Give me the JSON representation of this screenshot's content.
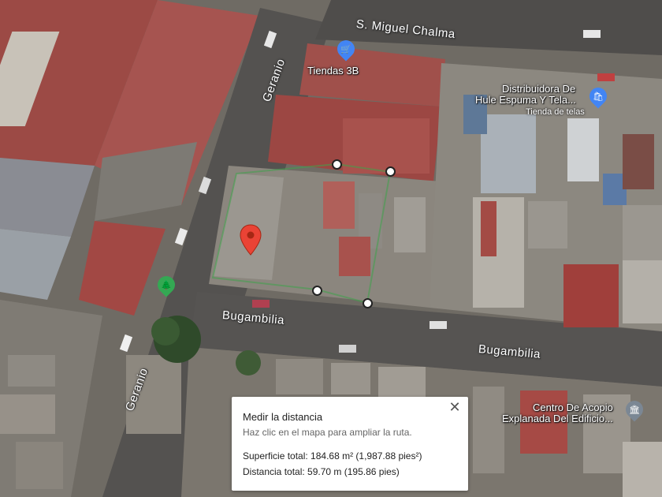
{
  "map": {
    "streets": {
      "miguel_chalma": "S. Miguel Chalma",
      "geranio_top": "Geranio",
      "geranio_bottom": "Geranio",
      "bugambilia_left": "Bugambilia",
      "bugambilia_right": "Bugambilia"
    },
    "pois": {
      "tiendas": {
        "name": "Tiendas 3B",
        "icon": "shopping-cart-icon",
        "color": "#4285f4"
      },
      "distribuidora": {
        "name_line1": "Distribuidora De",
        "name_line2": "Hule Espuma Y Tela...",
        "category": "Tienda de telas",
        "icon": "shopping-bag-icon",
        "color": "#4285f4"
      },
      "centro": {
        "name_line1": "Centro De Acopio",
        "name_line2": "Explanada Del Edificio...",
        "icon": "building-icon",
        "color": "#7b8794"
      },
      "park": {
        "icon": "tree-icon",
        "color": "#34a853"
      }
    },
    "marker_color": "#ea4335"
  },
  "measure": {
    "title": "Medir la distancia",
    "hint": "Haz clic en el mapa para ampliar la ruta.",
    "area": "Superficie total: 184.68 m² (1,987.88 pies²)",
    "distance": "Distancia total: 59.70 m (195.86 pies)",
    "close": "✕"
  }
}
